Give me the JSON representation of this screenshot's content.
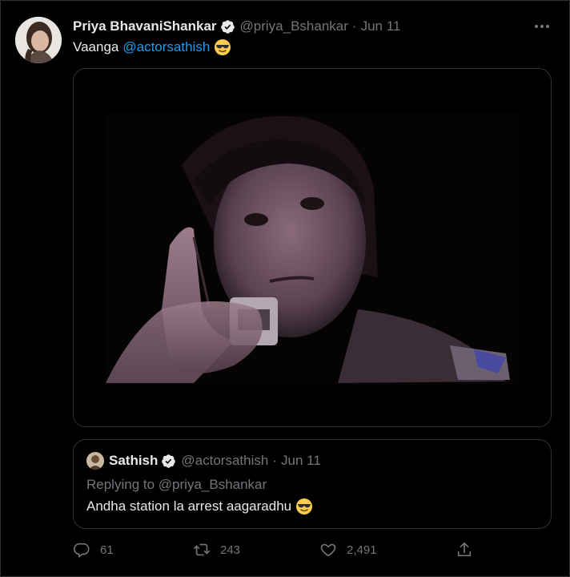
{
  "tweet": {
    "author_name": "Priya BhavaniShankar",
    "author_handle": "@priya_Bshankar",
    "separator": "·",
    "date": "Jun 11",
    "text_prefix": "Vaanga",
    "mention": "@actorsathish",
    "emoji": "sunglasses-face-emoji",
    "media": {
      "kind": "gif-still",
      "description_icon": "person-portrait-image"
    }
  },
  "quote": {
    "author_name": "Sathish",
    "author_handle": "@actorsathish",
    "separator": "·",
    "date": "Jun 11",
    "replying_prefix": "Replying to",
    "replying_to": "@priya_Bshankar",
    "text": "Andha station la arrest aagaradhu",
    "emoji": "sunglasses-face-emoji"
  },
  "actions": {
    "replies": "61",
    "retweets": "243",
    "likes": "2,491"
  },
  "colors": {
    "background": "#000000",
    "text": "#e7e9ea",
    "secondary": "#71767b",
    "accent": "#1d9bf0",
    "border": "#2f3336",
    "verified": "#e7e9ea"
  }
}
